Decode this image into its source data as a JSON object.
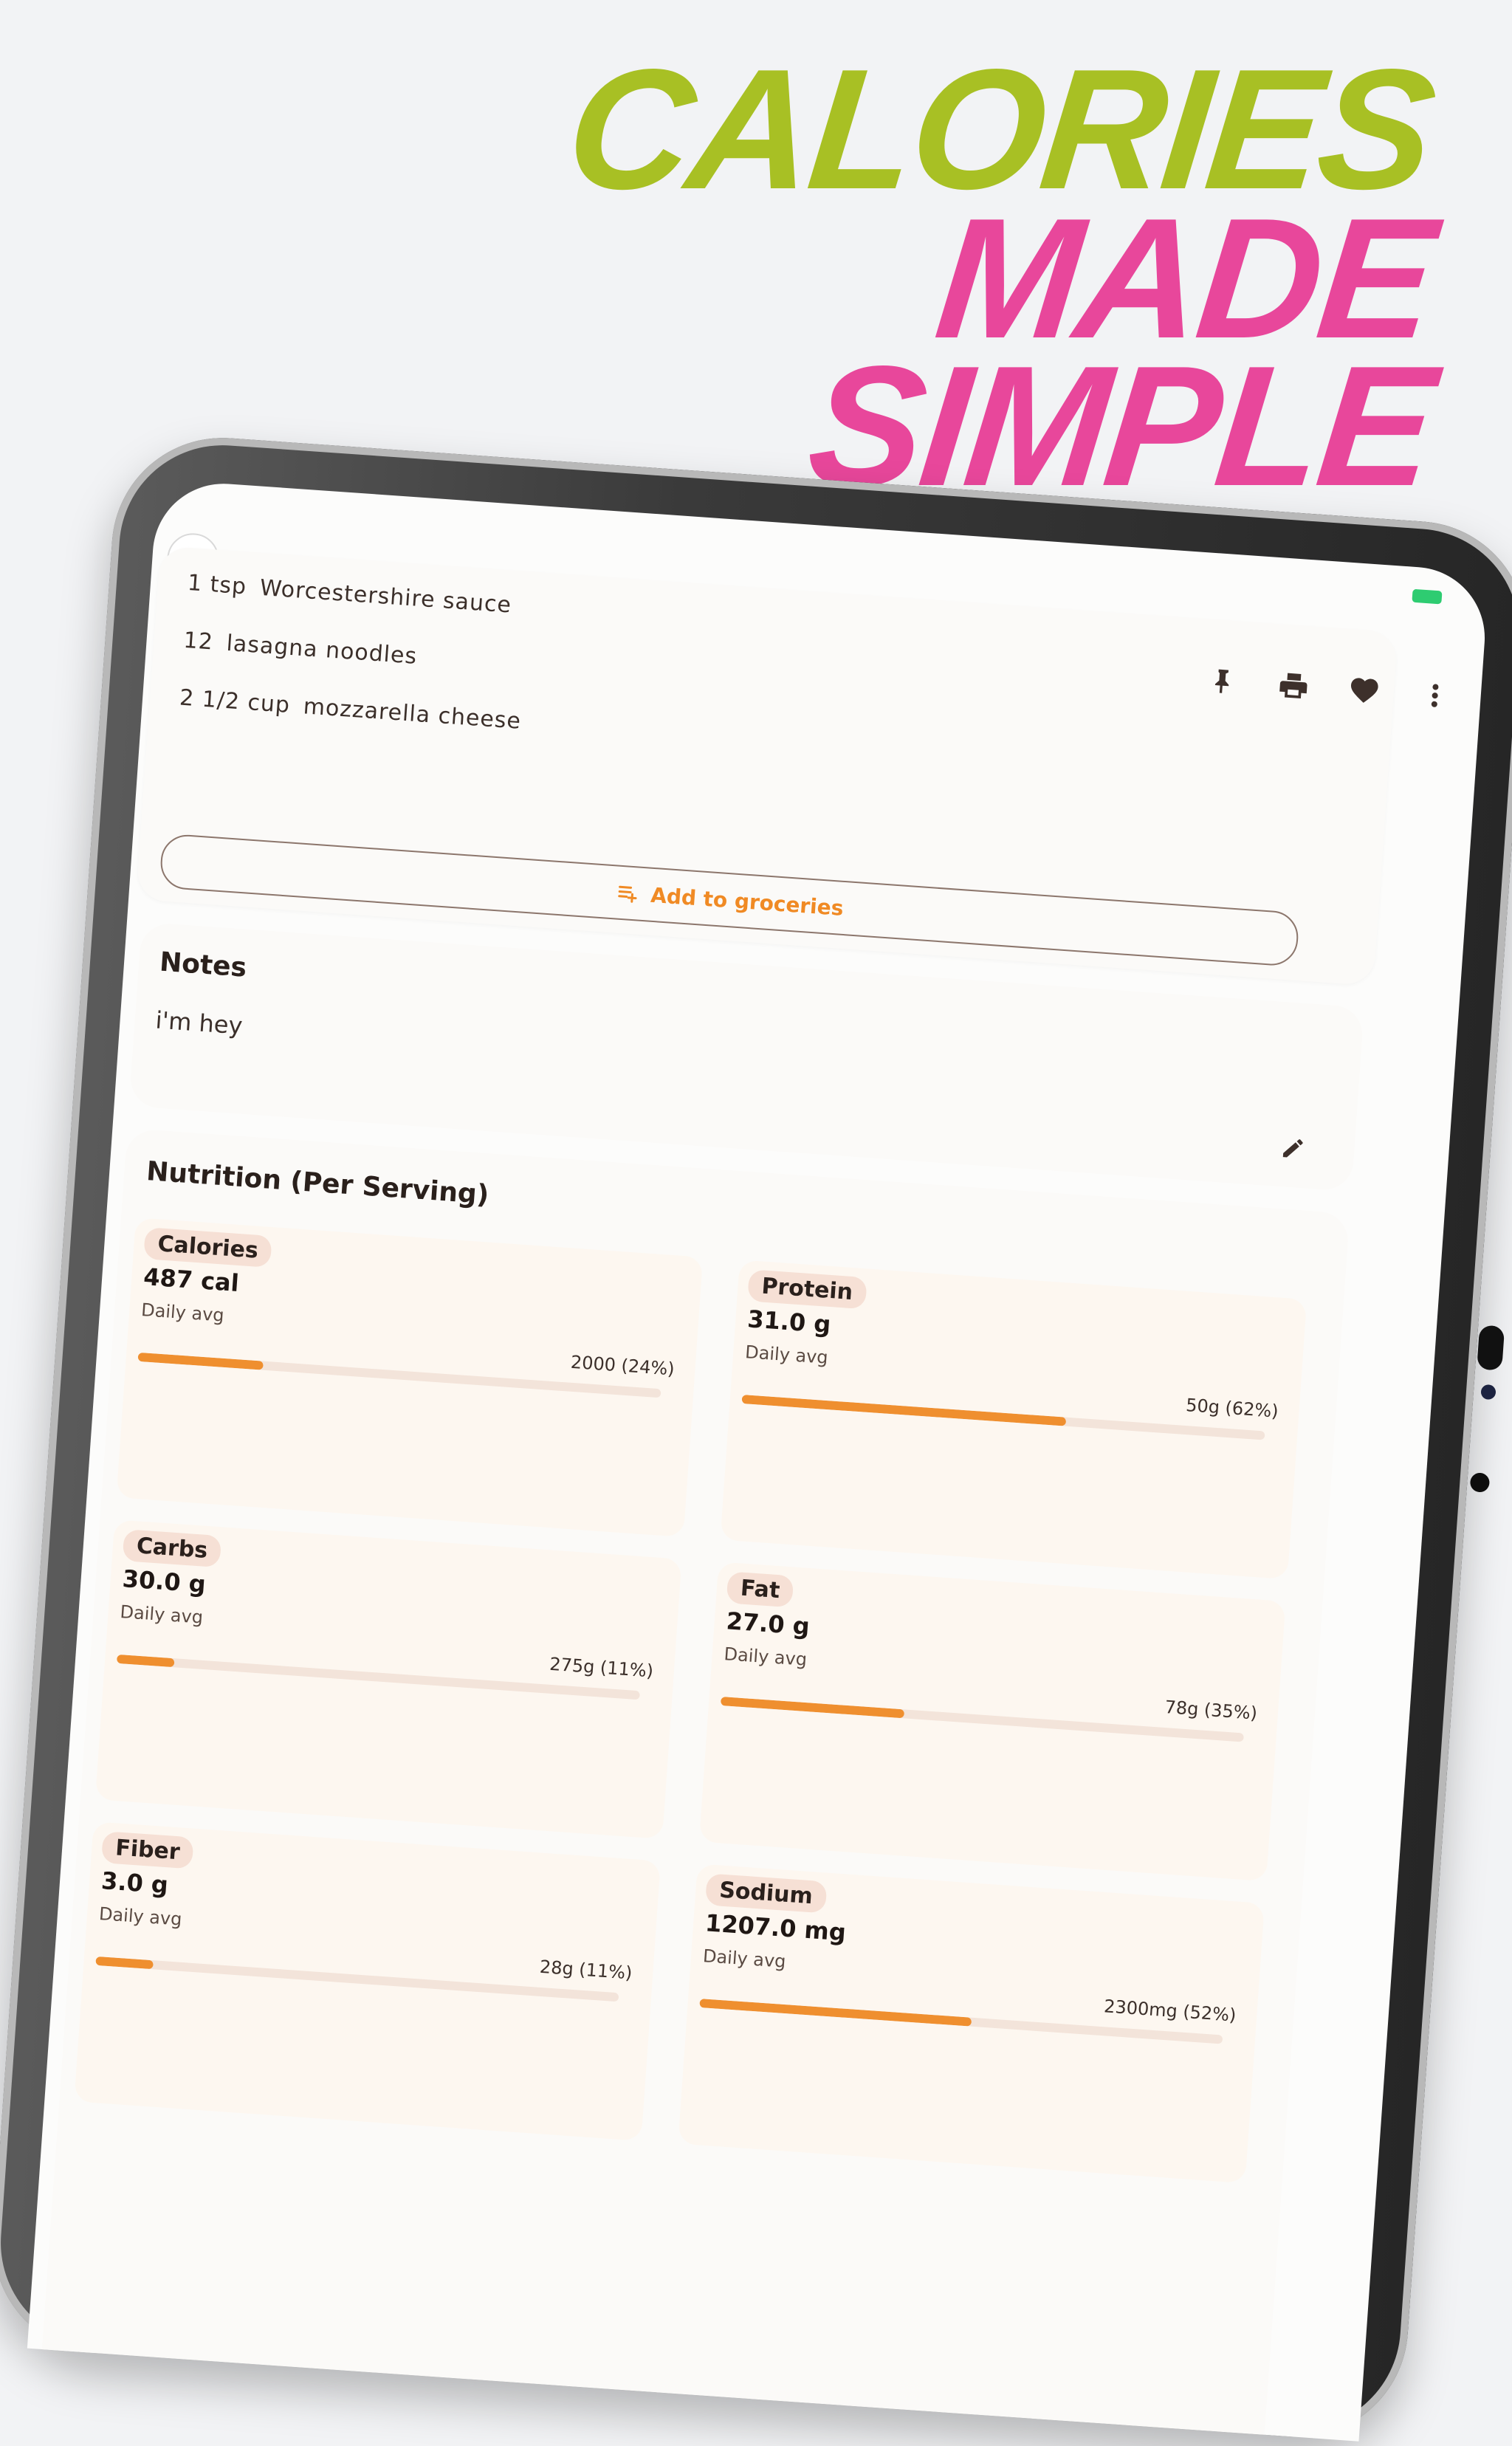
{
  "headline": {
    "line1": "CALORIES",
    "line2": "MADE",
    "line3": "SIMPLE",
    "color1": "#a8c024",
    "color2": "#e8479b"
  },
  "toolbar": {
    "icons": [
      "pin-icon",
      "print-icon",
      "heart-icon",
      "more-vert-icon"
    ]
  },
  "ingredients": [
    {
      "qty": "1 tsp",
      "name": "Worcestershire sauce"
    },
    {
      "qty": "12",
      "name": "lasagna noodles"
    },
    {
      "qty": "2 1/2 cup",
      "name": "mozzarella cheese"
    }
  ],
  "groceries": {
    "label": "Add to groceries",
    "icon": "playlist-add-icon"
  },
  "notes": {
    "title": "Notes",
    "text": "i'm hey",
    "edit_icon": "pencil-icon"
  },
  "nutrition": {
    "title": "Nutrition (Per Serving)",
    "daily_label": "Daily avg",
    "items": [
      {
        "name": "Calories",
        "value": "487 cal",
        "goal": "2000 (24%)",
        "pct": 24
      },
      {
        "name": "Protein",
        "value": "31.0 g",
        "goal": "50g (62%)",
        "pct": 62
      },
      {
        "name": "Carbs",
        "value": "30.0 g",
        "goal": "275g (11%)",
        "pct": 11
      },
      {
        "name": "Fat",
        "value": "27.0 g",
        "goal": "78g (35%)",
        "pct": 35
      },
      {
        "name": "Fiber",
        "value": "3.0 g",
        "goal": "28g (11%)",
        "pct": 11
      },
      {
        "name": "Sodium",
        "value": "1207.0 mg",
        "goal": "2300mg (52%)",
        "pct": 52
      }
    ]
  },
  "colors": {
    "accent": "#ef8f2f",
    "pill": "#f6e0d5",
    "text": "#3b2f2a"
  }
}
